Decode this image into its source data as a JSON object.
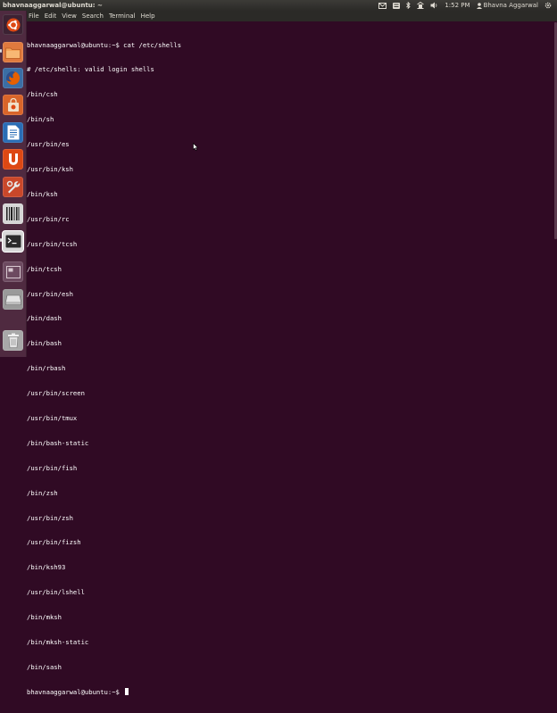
{
  "top_panel": {
    "window_title": "bhavnaaggarwal@ubuntu: ~",
    "clock": "1:52 PM",
    "user": "Bhavna Aggarwal"
  },
  "menu": {
    "items": [
      "File",
      "Edit",
      "View",
      "Search",
      "Terminal",
      "Help"
    ]
  },
  "launcher": {
    "items": [
      {
        "name": "Dash home",
        "icon": "ubuntu-logo-icon",
        "color": "#d66a3c"
      },
      {
        "name": "Files",
        "icon": "folder-icon",
        "color": "#e8824a"
      },
      {
        "name": "Firefox",
        "icon": "firefox-icon",
        "color": "#e66000"
      },
      {
        "name": "Software Center",
        "icon": "shopping-bag-icon",
        "color": "#dd6a2d"
      },
      {
        "name": "LibreOffice Writer",
        "icon": "document-icon",
        "color": "#2e6fb8"
      },
      {
        "name": "Ubuntu One",
        "icon": "ubuntu-one-icon",
        "color": "#dd4814"
      },
      {
        "name": "System Settings",
        "icon": "wrench-icon",
        "color": "#c44a2a"
      },
      {
        "name": "Disk utility",
        "icon": "barcode-icon",
        "color": "#cfcfcf"
      },
      {
        "name": "Terminal",
        "icon": "terminal-icon",
        "color": "#2e2e2e"
      },
      {
        "name": "Workspace switcher",
        "icon": "workspace-icon",
        "color": "#6a4a5e"
      },
      {
        "name": "Drive",
        "icon": "drive-icon",
        "color": "#8a8a8a"
      },
      {
        "name": "Trash",
        "icon": "trash-icon",
        "color": "#9a9a9a"
      }
    ]
  },
  "terminal": {
    "lines": [
      "bhavnaaggarwal@ubuntu:~$ cat /etc/shells",
      "# /etc/shells: valid login shells",
      "/bin/csh",
      "/bin/sh",
      "/usr/bin/es",
      "/usr/bin/ksh",
      "/bin/ksh",
      "/usr/bin/rc",
      "/usr/bin/tcsh",
      "/bin/tcsh",
      "/usr/bin/esh",
      "/bin/dash",
      "/bin/bash",
      "/bin/rbash",
      "/usr/bin/screen",
      "/usr/bin/tmux",
      "/bin/bash-static",
      "/usr/bin/fish",
      "/bin/zsh",
      "/usr/bin/zsh",
      "/usr/bin/fizsh",
      "/bin/ksh93",
      "/usr/bin/lshell",
      "/bin/mksh",
      "/bin/mksh-static",
      "/bin/sash"
    ],
    "prompt": "bhavnaaggarwal@ubuntu:~$ ",
    "background": "#300a24",
    "foreground": "#ffffff"
  }
}
